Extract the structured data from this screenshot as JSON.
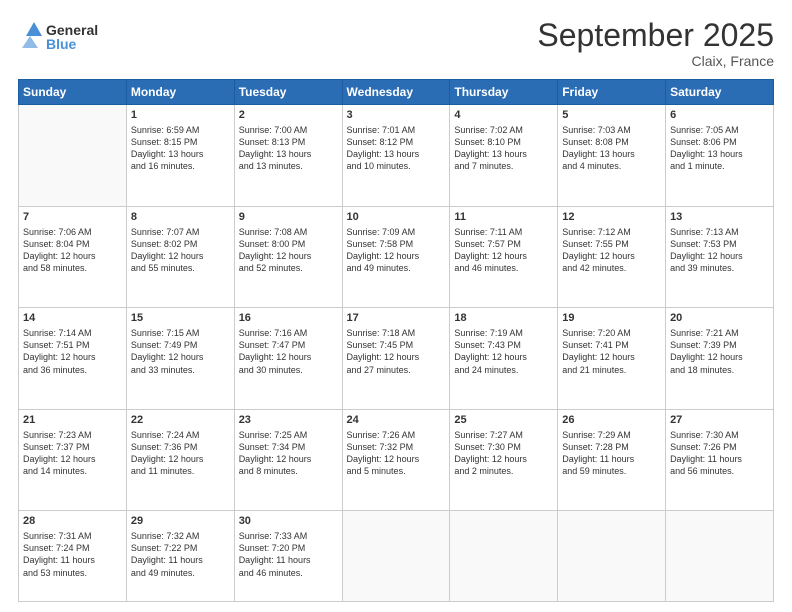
{
  "header": {
    "logo_line1": "General",
    "logo_line2": "Blue",
    "month": "September 2025",
    "location": "Claix, France"
  },
  "weekdays": [
    "Sunday",
    "Monday",
    "Tuesday",
    "Wednesday",
    "Thursday",
    "Friday",
    "Saturday"
  ],
  "weeks": [
    [
      {
        "day": "",
        "info": ""
      },
      {
        "day": "1",
        "info": "Sunrise: 6:59 AM\nSunset: 8:15 PM\nDaylight: 13 hours\nand 16 minutes."
      },
      {
        "day": "2",
        "info": "Sunrise: 7:00 AM\nSunset: 8:13 PM\nDaylight: 13 hours\nand 13 minutes."
      },
      {
        "day": "3",
        "info": "Sunrise: 7:01 AM\nSunset: 8:12 PM\nDaylight: 13 hours\nand 10 minutes."
      },
      {
        "day": "4",
        "info": "Sunrise: 7:02 AM\nSunset: 8:10 PM\nDaylight: 13 hours\nand 7 minutes."
      },
      {
        "day": "5",
        "info": "Sunrise: 7:03 AM\nSunset: 8:08 PM\nDaylight: 13 hours\nand 4 minutes."
      },
      {
        "day": "6",
        "info": "Sunrise: 7:05 AM\nSunset: 8:06 PM\nDaylight: 13 hours\nand 1 minute."
      }
    ],
    [
      {
        "day": "7",
        "info": "Sunrise: 7:06 AM\nSunset: 8:04 PM\nDaylight: 12 hours\nand 58 minutes."
      },
      {
        "day": "8",
        "info": "Sunrise: 7:07 AM\nSunset: 8:02 PM\nDaylight: 12 hours\nand 55 minutes."
      },
      {
        "day": "9",
        "info": "Sunrise: 7:08 AM\nSunset: 8:00 PM\nDaylight: 12 hours\nand 52 minutes."
      },
      {
        "day": "10",
        "info": "Sunrise: 7:09 AM\nSunset: 7:58 PM\nDaylight: 12 hours\nand 49 minutes."
      },
      {
        "day": "11",
        "info": "Sunrise: 7:11 AM\nSunset: 7:57 PM\nDaylight: 12 hours\nand 46 minutes."
      },
      {
        "day": "12",
        "info": "Sunrise: 7:12 AM\nSunset: 7:55 PM\nDaylight: 12 hours\nand 42 minutes."
      },
      {
        "day": "13",
        "info": "Sunrise: 7:13 AM\nSunset: 7:53 PM\nDaylight: 12 hours\nand 39 minutes."
      }
    ],
    [
      {
        "day": "14",
        "info": "Sunrise: 7:14 AM\nSunset: 7:51 PM\nDaylight: 12 hours\nand 36 minutes."
      },
      {
        "day": "15",
        "info": "Sunrise: 7:15 AM\nSunset: 7:49 PM\nDaylight: 12 hours\nand 33 minutes."
      },
      {
        "day": "16",
        "info": "Sunrise: 7:16 AM\nSunset: 7:47 PM\nDaylight: 12 hours\nand 30 minutes."
      },
      {
        "day": "17",
        "info": "Sunrise: 7:18 AM\nSunset: 7:45 PM\nDaylight: 12 hours\nand 27 minutes."
      },
      {
        "day": "18",
        "info": "Sunrise: 7:19 AM\nSunset: 7:43 PM\nDaylight: 12 hours\nand 24 minutes."
      },
      {
        "day": "19",
        "info": "Sunrise: 7:20 AM\nSunset: 7:41 PM\nDaylight: 12 hours\nand 21 minutes."
      },
      {
        "day": "20",
        "info": "Sunrise: 7:21 AM\nSunset: 7:39 PM\nDaylight: 12 hours\nand 18 minutes."
      }
    ],
    [
      {
        "day": "21",
        "info": "Sunrise: 7:23 AM\nSunset: 7:37 PM\nDaylight: 12 hours\nand 14 minutes."
      },
      {
        "day": "22",
        "info": "Sunrise: 7:24 AM\nSunset: 7:36 PM\nDaylight: 12 hours\nand 11 minutes."
      },
      {
        "day": "23",
        "info": "Sunrise: 7:25 AM\nSunset: 7:34 PM\nDaylight: 12 hours\nand 8 minutes."
      },
      {
        "day": "24",
        "info": "Sunrise: 7:26 AM\nSunset: 7:32 PM\nDaylight: 12 hours\nand 5 minutes."
      },
      {
        "day": "25",
        "info": "Sunrise: 7:27 AM\nSunset: 7:30 PM\nDaylight: 12 hours\nand 2 minutes."
      },
      {
        "day": "26",
        "info": "Sunrise: 7:29 AM\nSunset: 7:28 PM\nDaylight: 11 hours\nand 59 minutes."
      },
      {
        "day": "27",
        "info": "Sunrise: 7:30 AM\nSunset: 7:26 PM\nDaylight: 11 hours\nand 56 minutes."
      }
    ],
    [
      {
        "day": "28",
        "info": "Sunrise: 7:31 AM\nSunset: 7:24 PM\nDaylight: 11 hours\nand 53 minutes."
      },
      {
        "day": "29",
        "info": "Sunrise: 7:32 AM\nSunset: 7:22 PM\nDaylight: 11 hours\nand 49 minutes."
      },
      {
        "day": "30",
        "info": "Sunrise: 7:33 AM\nSunset: 7:20 PM\nDaylight: 11 hours\nand 46 minutes."
      },
      {
        "day": "",
        "info": ""
      },
      {
        "day": "",
        "info": ""
      },
      {
        "day": "",
        "info": ""
      },
      {
        "day": "",
        "info": ""
      }
    ]
  ]
}
